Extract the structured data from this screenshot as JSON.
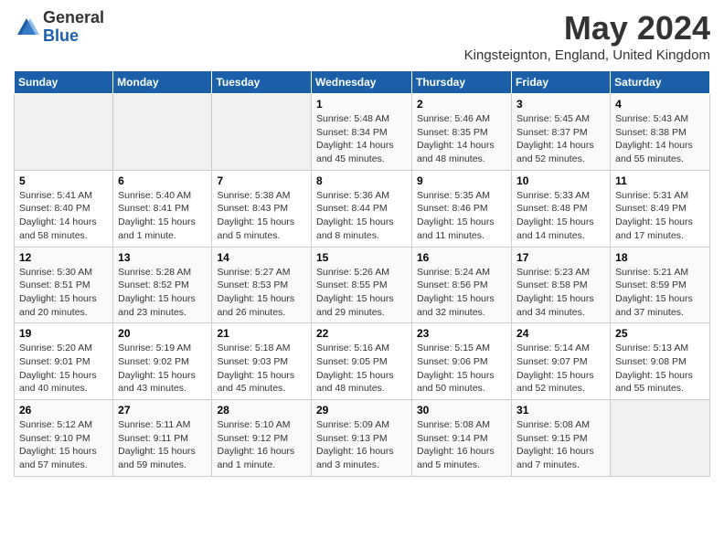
{
  "header": {
    "logo_general": "General",
    "logo_blue": "Blue",
    "month_title": "May 2024",
    "location": "Kingsteignton, England, United Kingdom"
  },
  "weekdays": [
    "Sunday",
    "Monday",
    "Tuesday",
    "Wednesday",
    "Thursday",
    "Friday",
    "Saturday"
  ],
  "weeks": [
    [
      {
        "day": "",
        "info": ""
      },
      {
        "day": "",
        "info": ""
      },
      {
        "day": "",
        "info": ""
      },
      {
        "day": "1",
        "info": "Sunrise: 5:48 AM\nSunset: 8:34 PM\nDaylight: 14 hours\nand 45 minutes."
      },
      {
        "day": "2",
        "info": "Sunrise: 5:46 AM\nSunset: 8:35 PM\nDaylight: 14 hours\nand 48 minutes."
      },
      {
        "day": "3",
        "info": "Sunrise: 5:45 AM\nSunset: 8:37 PM\nDaylight: 14 hours\nand 52 minutes."
      },
      {
        "day": "4",
        "info": "Sunrise: 5:43 AM\nSunset: 8:38 PM\nDaylight: 14 hours\nand 55 minutes."
      }
    ],
    [
      {
        "day": "5",
        "info": "Sunrise: 5:41 AM\nSunset: 8:40 PM\nDaylight: 14 hours\nand 58 minutes."
      },
      {
        "day": "6",
        "info": "Sunrise: 5:40 AM\nSunset: 8:41 PM\nDaylight: 15 hours\nand 1 minute."
      },
      {
        "day": "7",
        "info": "Sunrise: 5:38 AM\nSunset: 8:43 PM\nDaylight: 15 hours\nand 5 minutes."
      },
      {
        "day": "8",
        "info": "Sunrise: 5:36 AM\nSunset: 8:44 PM\nDaylight: 15 hours\nand 8 minutes."
      },
      {
        "day": "9",
        "info": "Sunrise: 5:35 AM\nSunset: 8:46 PM\nDaylight: 15 hours\nand 11 minutes."
      },
      {
        "day": "10",
        "info": "Sunrise: 5:33 AM\nSunset: 8:48 PM\nDaylight: 15 hours\nand 14 minutes."
      },
      {
        "day": "11",
        "info": "Sunrise: 5:31 AM\nSunset: 8:49 PM\nDaylight: 15 hours\nand 17 minutes."
      }
    ],
    [
      {
        "day": "12",
        "info": "Sunrise: 5:30 AM\nSunset: 8:51 PM\nDaylight: 15 hours\nand 20 minutes."
      },
      {
        "day": "13",
        "info": "Sunrise: 5:28 AM\nSunset: 8:52 PM\nDaylight: 15 hours\nand 23 minutes."
      },
      {
        "day": "14",
        "info": "Sunrise: 5:27 AM\nSunset: 8:53 PM\nDaylight: 15 hours\nand 26 minutes."
      },
      {
        "day": "15",
        "info": "Sunrise: 5:26 AM\nSunset: 8:55 PM\nDaylight: 15 hours\nand 29 minutes."
      },
      {
        "day": "16",
        "info": "Sunrise: 5:24 AM\nSunset: 8:56 PM\nDaylight: 15 hours\nand 32 minutes."
      },
      {
        "day": "17",
        "info": "Sunrise: 5:23 AM\nSunset: 8:58 PM\nDaylight: 15 hours\nand 34 minutes."
      },
      {
        "day": "18",
        "info": "Sunrise: 5:21 AM\nSunset: 8:59 PM\nDaylight: 15 hours\nand 37 minutes."
      }
    ],
    [
      {
        "day": "19",
        "info": "Sunrise: 5:20 AM\nSunset: 9:01 PM\nDaylight: 15 hours\nand 40 minutes."
      },
      {
        "day": "20",
        "info": "Sunrise: 5:19 AM\nSunset: 9:02 PM\nDaylight: 15 hours\nand 43 minutes."
      },
      {
        "day": "21",
        "info": "Sunrise: 5:18 AM\nSunset: 9:03 PM\nDaylight: 15 hours\nand 45 minutes."
      },
      {
        "day": "22",
        "info": "Sunrise: 5:16 AM\nSunset: 9:05 PM\nDaylight: 15 hours\nand 48 minutes."
      },
      {
        "day": "23",
        "info": "Sunrise: 5:15 AM\nSunset: 9:06 PM\nDaylight: 15 hours\nand 50 minutes."
      },
      {
        "day": "24",
        "info": "Sunrise: 5:14 AM\nSunset: 9:07 PM\nDaylight: 15 hours\nand 52 minutes."
      },
      {
        "day": "25",
        "info": "Sunrise: 5:13 AM\nSunset: 9:08 PM\nDaylight: 15 hours\nand 55 minutes."
      }
    ],
    [
      {
        "day": "26",
        "info": "Sunrise: 5:12 AM\nSunset: 9:10 PM\nDaylight: 15 hours\nand 57 minutes."
      },
      {
        "day": "27",
        "info": "Sunrise: 5:11 AM\nSunset: 9:11 PM\nDaylight: 15 hours\nand 59 minutes."
      },
      {
        "day": "28",
        "info": "Sunrise: 5:10 AM\nSunset: 9:12 PM\nDaylight: 16 hours\nand 1 minute."
      },
      {
        "day": "29",
        "info": "Sunrise: 5:09 AM\nSunset: 9:13 PM\nDaylight: 16 hours\nand 3 minutes."
      },
      {
        "day": "30",
        "info": "Sunrise: 5:08 AM\nSunset: 9:14 PM\nDaylight: 16 hours\nand 5 minutes."
      },
      {
        "day": "31",
        "info": "Sunrise: 5:08 AM\nSunset: 9:15 PM\nDaylight: 16 hours\nand 7 minutes."
      },
      {
        "day": "",
        "info": ""
      }
    ]
  ]
}
